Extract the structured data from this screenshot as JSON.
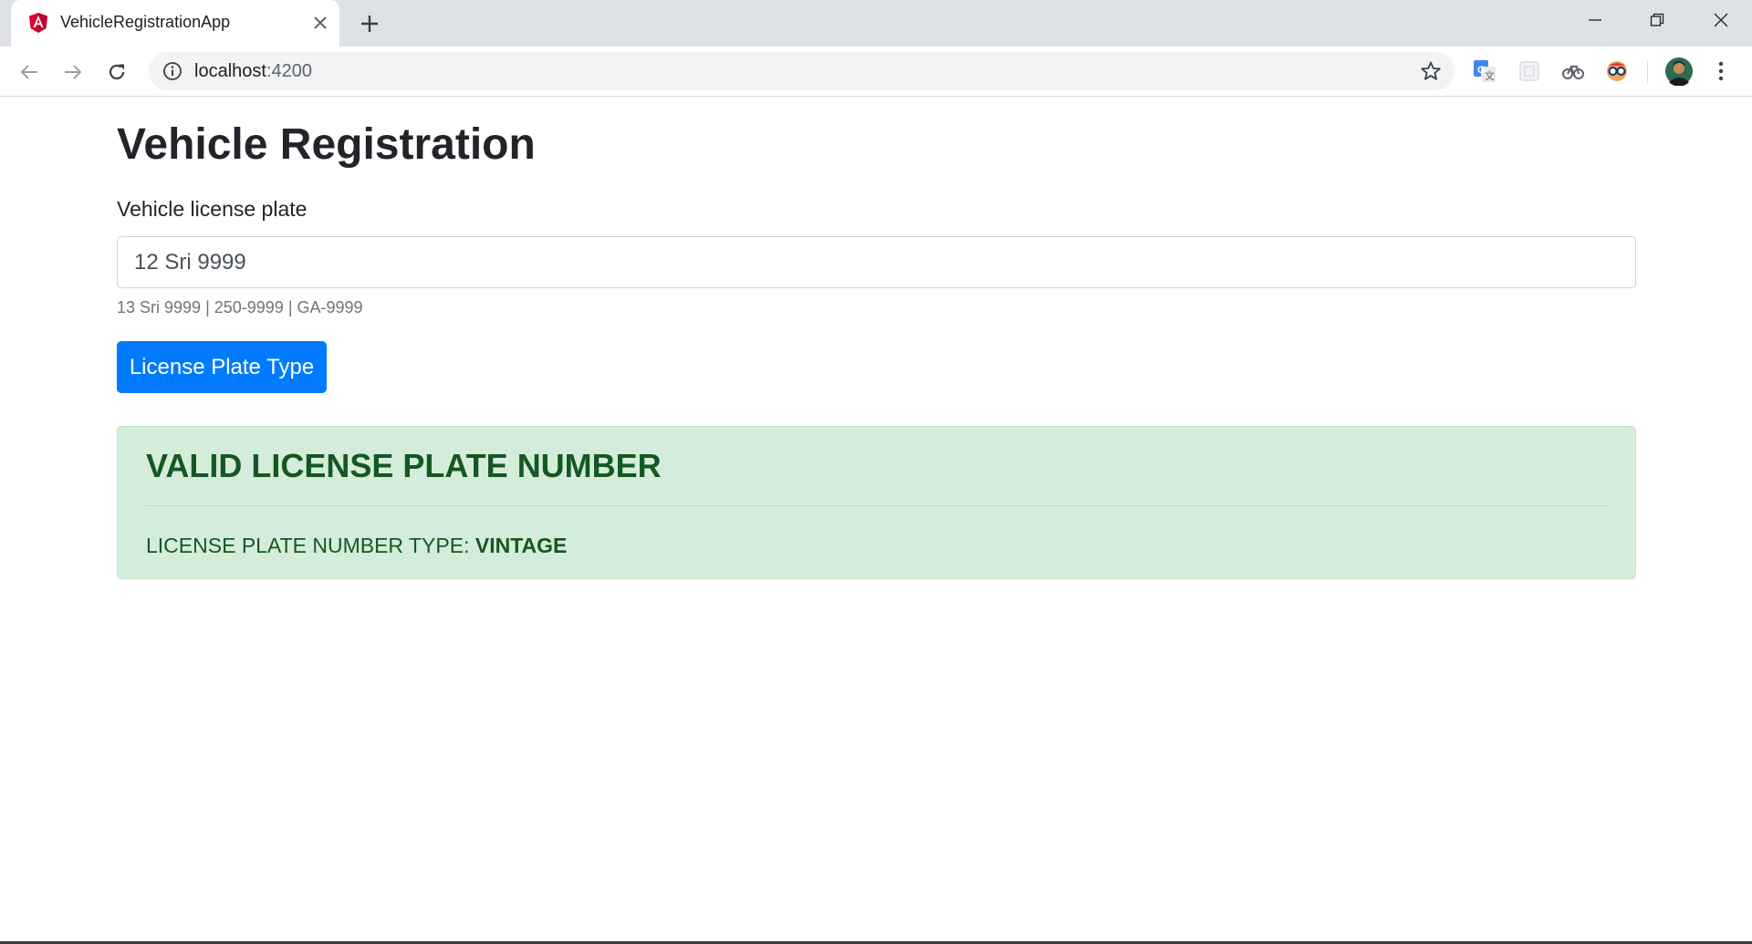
{
  "browser": {
    "tab_title": "VehicleRegistrationApp",
    "url_host": "localhost",
    "url_port": ":4200",
    "icons": {
      "favicon": "angular-icon",
      "close_tab": "close-icon",
      "new_tab": "plus-icon",
      "minimize": "minimize-icon",
      "restore": "restore-icon",
      "close_window": "close-icon",
      "back": "arrow-left-icon",
      "forward": "arrow-right-icon",
      "reload": "reload-icon",
      "site_info": "info-icon",
      "bookmark": "star-icon",
      "menu": "kebab-icon"
    },
    "extensions": [
      "translate-icon",
      "extension-icon",
      "bicycle-icon",
      "glasses-icon"
    ]
  },
  "page": {
    "title": "Vehicle Registration",
    "field_label": "Vehicle license plate",
    "input_value": "12 Sri 9999",
    "help_text": "13 Sri 9999 | 250-9999 | GA-9999",
    "button_label": "License Plate Type"
  },
  "alert": {
    "heading": "VALID LICENSE PLATE NUMBER",
    "type_label": "LICENSE PLATE NUMBER TYPE: ",
    "type_value": "VINTAGE"
  },
  "colors": {
    "primary": "#007bff",
    "success_bg": "#d4edda",
    "success_text": "#155724",
    "angular_red": "#dd0031"
  }
}
